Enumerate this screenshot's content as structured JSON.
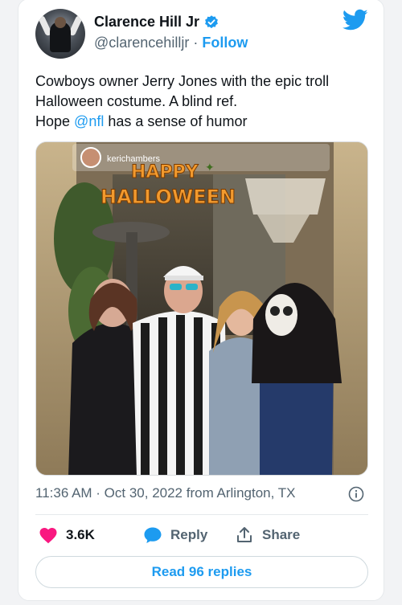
{
  "user": {
    "display_name": "Clarence Hill Jr",
    "handle": "@clarencehilljr",
    "separator": "·",
    "follow_label": "Follow"
  },
  "tweet": {
    "line1": "Cowboys owner Jerry Jones with the epic troll",
    "line2": "Halloween costume. A blind ref.",
    "line3_prefix": "Hope ",
    "line3_mention": "@nfl",
    "line3_suffix": " has a sense of humor"
  },
  "media": {
    "story_username": "kerichambers",
    "overlay_line1": "HAPPY",
    "overlay_line2": "HALLOWEEN"
  },
  "meta": {
    "timestamp": "11:36 AM · Oct 30, 2022 from Arlington, TX"
  },
  "actions": {
    "like_count": "3.6K",
    "reply_label": "Reply",
    "share_label": "Share"
  },
  "footer": {
    "read_replies_label": "Read 96 replies"
  },
  "colors": {
    "accent": "#1d9bf0",
    "like": "#f91880",
    "muted": "#536471"
  }
}
